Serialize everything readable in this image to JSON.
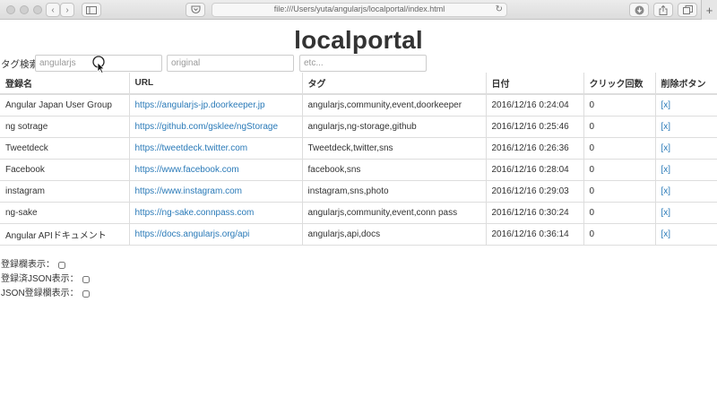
{
  "browser": {
    "address": "file:///Users/yuta/angularjs/localportal/index.html",
    "nav_back": "‹",
    "nav_forward": "›",
    "new_tab": "+"
  },
  "page": {
    "title": "localportal",
    "tag_label": "タグ検索",
    "tag_inputs": [
      {
        "value": "",
        "placeholder": "angularjs"
      },
      {
        "value": "",
        "placeholder": "original"
      },
      {
        "value": "",
        "placeholder": "etc..."
      }
    ]
  },
  "table": {
    "headers": [
      "登録名",
      "URL",
      "タグ",
      "日付",
      "クリック回数",
      "削除ボタン"
    ],
    "rows": [
      {
        "name": "Angular Japan User Group",
        "url": "https://angularjs-jp.doorkeeper.jp",
        "tags": "angularjs,community,event,doorkeeper",
        "date": "2016/12/16 0:24:04",
        "clicks": "0",
        "delete": "[x]"
      },
      {
        "name": "ng sotrage",
        "url": "https://github.com/gsklee/ngStorage",
        "tags": "angularjs,ng-storage,github",
        "date": "2016/12/16 0:25:46",
        "clicks": "0",
        "delete": "[x]"
      },
      {
        "name": "Tweetdeck",
        "url": "https://tweetdeck.twitter.com",
        "tags": "Tweetdeck,twitter,sns",
        "date": "2016/12/16 0:26:36",
        "clicks": "0",
        "delete": "[x]"
      },
      {
        "name": "Facebook",
        "url": "https://www.facebook.com",
        "tags": "facebook,sns",
        "date": "2016/12/16 0:28:04",
        "clicks": "0",
        "delete": "[x]"
      },
      {
        "name": "instagram",
        "url": "https://www.instagram.com",
        "tags": "instagram,sns,photo",
        "date": "2016/12/16 0:29:03",
        "clicks": "0",
        "delete": "[x]"
      },
      {
        "name": "ng-sake",
        "url": "https://ng-sake.connpass.com",
        "tags": "angularjs,community,event,conn pass",
        "date": "2016/12/16 0:30:24",
        "clicks": "0",
        "delete": "[x]"
      },
      {
        "name": "Angular APIドキュメント",
        "url": "https://docs.angularjs.org/api",
        "tags": "angularjs,api,docs",
        "date": "2016/12/16 0:36:14",
        "clicks": "0",
        "delete": "[x]"
      }
    ]
  },
  "toggles": [
    {
      "label": "登録欄表示：",
      "checked": false
    },
    {
      "label": "登録済JSON表示：",
      "checked": false
    },
    {
      "label": "JSON登録欄表示：",
      "checked": false
    }
  ]
}
